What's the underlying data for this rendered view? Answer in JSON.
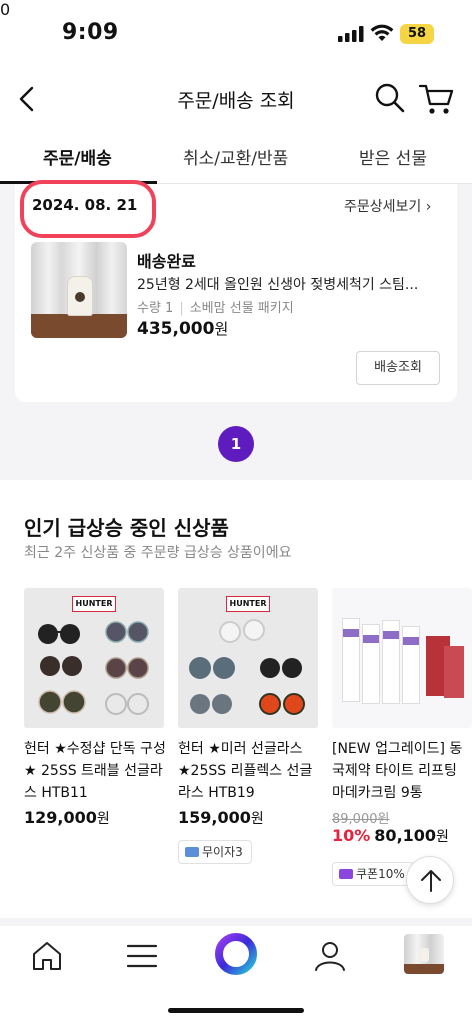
{
  "status_bar": {
    "time": "9:09",
    "battery": "58"
  },
  "header": {
    "title": "주문/배송 조회",
    "cart_count": "0"
  },
  "tabs": [
    {
      "label": "주문/배송",
      "active": true
    },
    {
      "label": "취소/교환/반품",
      "active": false
    },
    {
      "label": "받은 선물",
      "active": false
    }
  ],
  "order": {
    "date": "2024. 08. 21",
    "detail_link": "주문상세보기 ›",
    "status": "배송완료",
    "product_name": "25년형 2세대 올인원 신생아 젖병세척기 스팀...",
    "quantity": "수량 1",
    "option": "소베맘 선물 패키지",
    "price": "435,000",
    "currency": "원",
    "track_button": "배송조회"
  },
  "pagination": {
    "current": "1"
  },
  "recommend": {
    "title": "인기 급상승 중인 신상품",
    "subtitle": "최근 2주 신상품 중 주문량 급상승 상품이에요",
    "products": [
      {
        "name": "헌터 ★수정샵 단독 구성★ 25SS 트래블 선글라스 HTB11",
        "price": "129,000",
        "currency": "원",
        "brand_logo": "HUNTER"
      },
      {
        "name": "헌터 ★미러 선글라스★25SS 리플렉스 선글라스 HTB19",
        "price": "159,000",
        "currency": "원",
        "brand_logo": "HUNTER",
        "tag": "무이자3"
      },
      {
        "name": "[NEW 업그레이드] 동국제약 타이트 리프팅 마데카크림 9통",
        "original_price": "89,000원",
        "discount": "10%",
        "price": "80,100",
        "currency": "원",
        "tag": "쿠폰10%"
      }
    ]
  },
  "colors": {
    "accent": "#5e1bbe",
    "sale_red": "#e8233e",
    "annotation_red": "#f0435a"
  },
  "icons": [
    "back-icon",
    "search-icon",
    "cart-icon",
    "home-icon",
    "menu-icon",
    "brand-ring-icon",
    "profile-icon",
    "arrow-up-icon"
  ]
}
